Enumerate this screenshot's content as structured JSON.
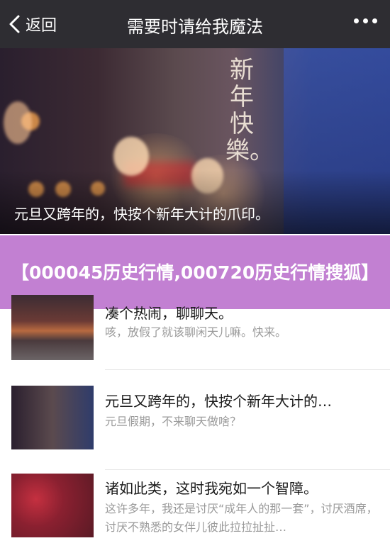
{
  "nav": {
    "back_label": "返回",
    "title": "需要时请给我魔法"
  },
  "hero": {
    "art_text": "新年快樂。",
    "caption": "元旦又跨年的，快按个新年大计的爪印。"
  },
  "banner": {
    "text": "【000045历史行情,000720历史行情搜狐】"
  },
  "articles": [
    {
      "title": "凑个热闹，聊聊天。",
      "desc": "咳，放假了就该聊闲天儿嘛。快来。"
    },
    {
      "title": "元旦又跨年的，快按个新年大计的…",
      "desc": "元旦假期，不来聊天做啥？"
    },
    {
      "title": "诸如此类，这时我宛如一个智障。",
      "desc": "这许多年，我还是讨厌“成年人的那一套”，讨厌酒席，讨厌不熟悉的女伴儿彼此拉拉扯扯…"
    }
  ],
  "colors": {
    "navbar": "#2e2d32",
    "banner": "#b464c8",
    "title_text": "#1a1a1a",
    "desc_text": "#9a9a9a"
  }
}
